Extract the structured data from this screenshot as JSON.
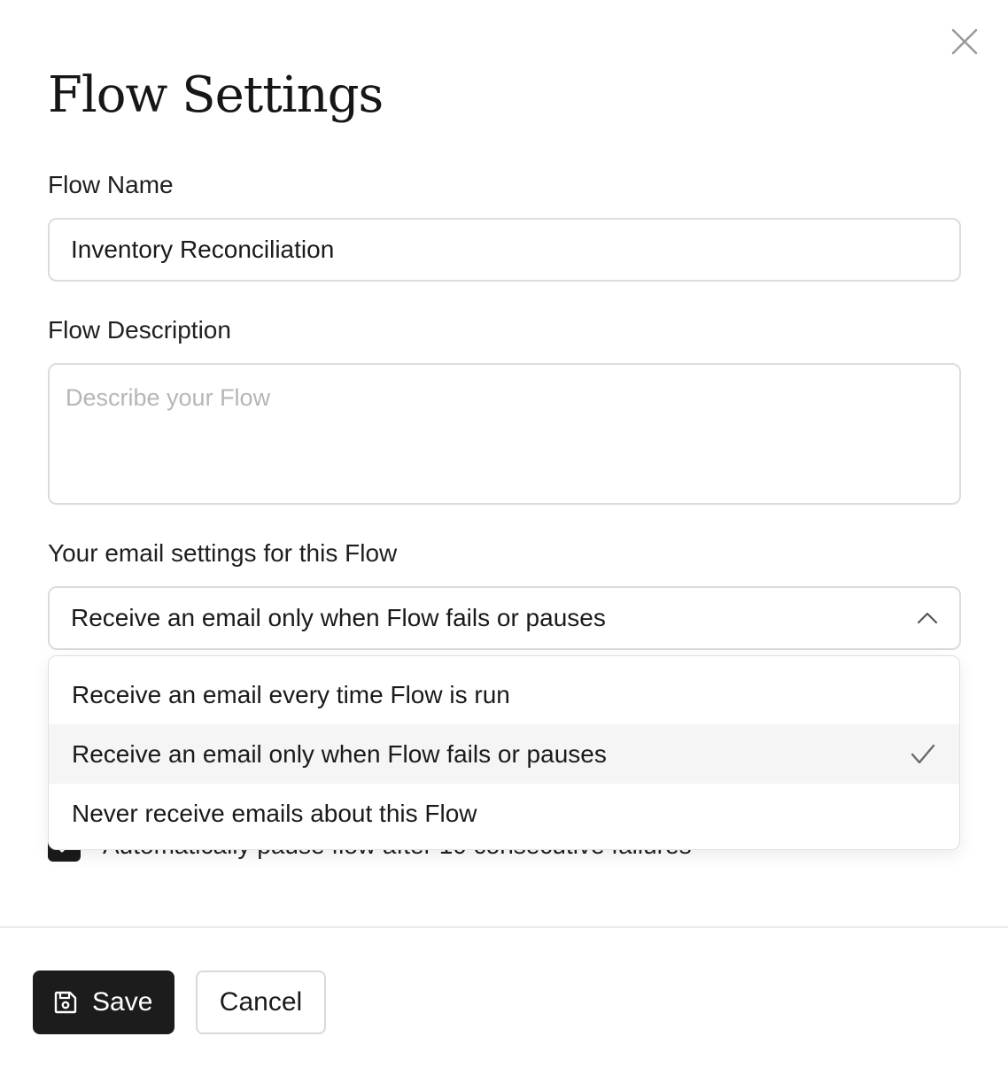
{
  "dialog": {
    "title": "Flow Settings",
    "close_icon": "close-icon"
  },
  "form": {
    "name_label": "Flow Name",
    "name_value": "Inventory Reconciliation",
    "description_label": "Flow Description",
    "description_value": "",
    "description_placeholder": "Describe your Flow",
    "email_label": "Your email settings for this Flow",
    "email_selected": "Receive an email only when Flow fails or pauses",
    "email_options": [
      {
        "label": "Receive an email every time Flow is run",
        "selected": false
      },
      {
        "label": "Receive an email only when Flow fails or pauses",
        "selected": true
      },
      {
        "label": "Never receive emails about this Flow",
        "selected": false
      }
    ],
    "auto_pause_label": "Automatically pause flow after 10 consecutive failures",
    "auto_pause_checked": true
  },
  "footer": {
    "save_label": "Save",
    "cancel_label": "Cancel"
  },
  "colors": {
    "primary_button": "#1c1c1c",
    "selected_option_bg": "#f5f5f5",
    "border": "#dcdcdc"
  }
}
